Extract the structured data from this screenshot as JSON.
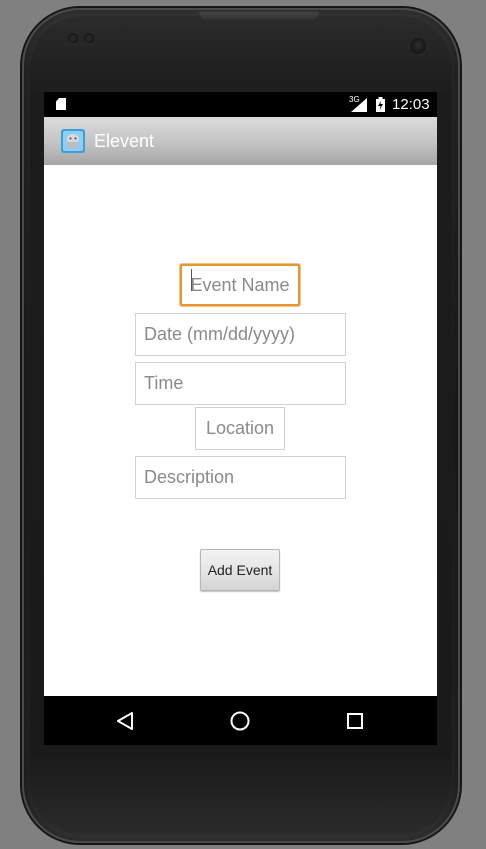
{
  "status_bar": {
    "network": "3G",
    "time": "12:03"
  },
  "action_bar": {
    "app_icon": "android-app-icon",
    "title": "Elevent"
  },
  "form": {
    "event_name": {
      "value": "",
      "placeholder": "Event Name"
    },
    "date": {
      "value": "",
      "placeholder": "Date (mm/dd/yyyy)"
    },
    "time": {
      "value": "",
      "placeholder": "Time"
    },
    "location": {
      "value": "",
      "placeholder": "Location"
    },
    "description": {
      "value": "",
      "placeholder": "Description"
    },
    "add_button_label": "Add Event"
  },
  "navigation": {
    "back_icon": "back-triangle-icon",
    "home_icon": "home-circle-icon",
    "recents_icon": "recents-square-icon"
  },
  "colors": {
    "focus_border": "#e8942f",
    "status_bar": "#000000",
    "nav_bar": "#000000"
  }
}
